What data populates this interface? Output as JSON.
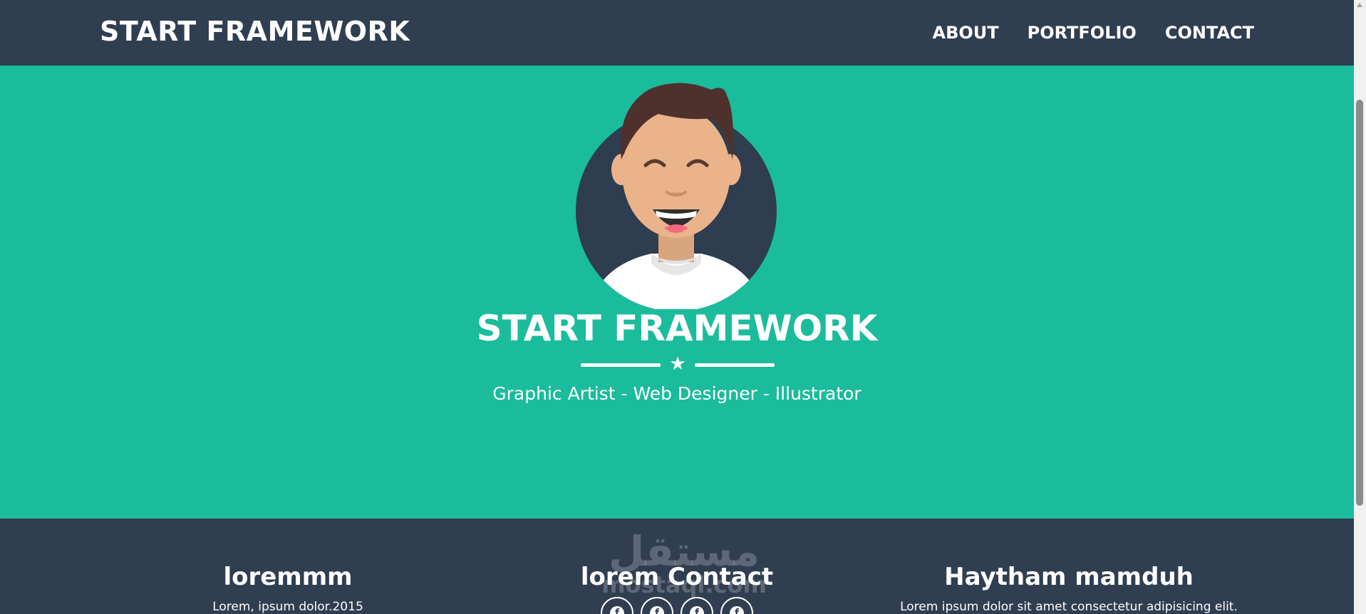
{
  "navbar": {
    "brand": "START FRAMEWORK",
    "links": [
      "ABOUT",
      "PORTFOLIO",
      "CONTACT"
    ]
  },
  "hero": {
    "title": "START FRAMEWORK",
    "subtitle": "Graphic Artist - Web Designer - Illustrator",
    "divider_icon": "star-icon",
    "avatar": "avatar-illustration"
  },
  "footer": {
    "col1": {
      "heading": "loremmm",
      "text": "Lorem, ipsum dolor.2015"
    },
    "col2": {
      "heading": "lorem Contact",
      "social_icons": [
        "facebook-icon",
        "facebook-icon",
        "facebook-icon",
        "facebook-icon"
      ]
    },
    "col3": {
      "heading": "Haytham mamduh",
      "text": "Lorem ipsum dolor sit amet consectetur adipisicing elit."
    }
  },
  "watermark": {
    "arabic": "مستقل",
    "latin": "mostaql.com"
  },
  "colors": {
    "navbar": "#2f3e51",
    "hero": "#1abc9c",
    "text": "#ffffff"
  }
}
